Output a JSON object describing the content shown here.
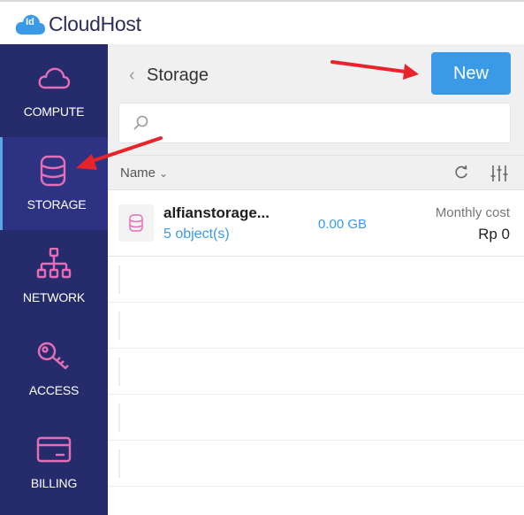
{
  "app": {
    "logo_badge": "Id",
    "logo_text": "CloudHost",
    "brand_color": "#3b9ae8"
  },
  "sidebar": {
    "items": [
      {
        "label": "COMPUTE",
        "icon": "cloud-icon",
        "active": false
      },
      {
        "label": "STORAGE",
        "icon": "database-icon",
        "active": true
      },
      {
        "label": "NETWORK",
        "icon": "network-icon",
        "active": false
      },
      {
        "label": "ACCESS",
        "icon": "key-icon",
        "active": false
      },
      {
        "label": "BILLING",
        "icon": "credit-card-icon",
        "active": false
      }
    ],
    "icon_color": "#e56fb7",
    "background": "#262c6b"
  },
  "header": {
    "title": "Storage",
    "new_label": "New"
  },
  "search": {
    "value": "",
    "placeholder": ""
  },
  "list": {
    "sort_label": "Name",
    "rows": [
      {
        "name": "alfianstorage...",
        "objects": "5 object(s)",
        "size": "0.00 GB",
        "cost_label": "Monthly cost",
        "cost": "Rp 0"
      }
    ]
  },
  "annotations": {
    "arrow_color": "#e8232a"
  }
}
